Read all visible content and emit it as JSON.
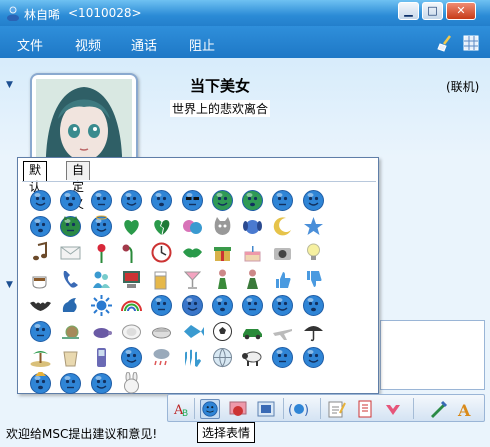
{
  "window": {
    "contact_name": "林自唏",
    "contact_id": "<1010028>",
    "controls": [
      "▁",
      "□",
      "✕"
    ]
  },
  "menu": {
    "items": [
      "文件",
      "视频",
      "通话",
      "阻止"
    ],
    "tools": [
      "clean-brush-icon",
      "grid-tool-icon"
    ]
  },
  "contact": {
    "display_name": "当下美女",
    "status": "(联机)",
    "signature": "世界上的悲欢离合",
    "avatar": "anime-girl-avatar"
  },
  "emoticon_picker": {
    "tabs": [
      "默 认",
      "自定义"
    ],
    "active_tab": 0,
    "icons": [
      [
        "smile",
        "happy",
        "wink",
        "surprised",
        "tongue",
        "sunglasses",
        "nerd",
        "angry",
        "ashamed",
        "confused"
      ],
      [
        "sad",
        "devil",
        "angel",
        "green-heart",
        "broken-heart",
        "couple",
        "cat",
        "dog",
        "moon",
        "star"
      ],
      [
        "music-note",
        "envelope",
        "rose",
        "wilted-rose",
        "clock",
        "lips",
        "gift",
        "cake",
        "camera",
        "lightbulb"
      ],
      [
        "coffee",
        "phone",
        "people",
        "computer",
        "beer",
        "cocktail",
        "person",
        "girl",
        "thumbs-up",
        "thumbs-down"
      ],
      [
        "bat",
        "goat",
        "sun",
        "rainbow",
        "crying",
        "angry-red",
        "embarrassed",
        "thinking",
        "blushing",
        "evil-grin"
      ],
      [
        "sleepy",
        "snail",
        "turtle",
        "plate",
        "dish",
        "fish",
        "soccer-ball",
        "car",
        "airplane",
        "umbrella"
      ],
      [
        "island",
        "cup",
        "cellphone",
        "moody",
        "rain",
        "hands",
        "globe",
        "sheep",
        "yawn",
        "eye-roll"
      ],
      [
        "party",
        "secret",
        "pray",
        "bunny"
      ]
    ],
    "accent_color": "#2f85d6"
  },
  "toolbar": {
    "buttons": [
      "font-icon",
      "emoticon-icon",
      "wink-icon",
      "background-icon",
      "nudge-icon",
      "draw-icon",
      "notepad-icon",
      "gift-icon",
      "handwrite-icon",
      "text-style-icon"
    ]
  },
  "tooltip": "选择表情",
  "status_bar": "欢迎给MSC提出建议和意见!"
}
